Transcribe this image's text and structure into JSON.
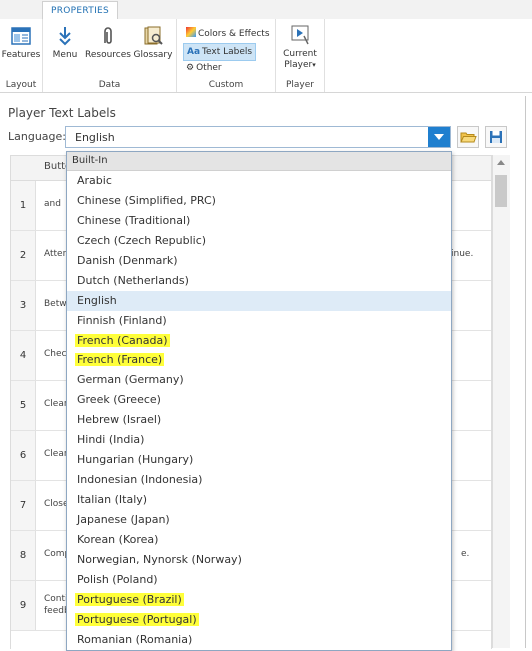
{
  "ribbon": {
    "tab": "PROPERTIES",
    "groups": {
      "layout": "Layout",
      "data": "Data",
      "custom": "Custom",
      "player": "Player"
    },
    "buttons": {
      "features": "Features",
      "menu": "Menu",
      "resources": "Resources",
      "glossary": "Glossary",
      "colors_effects": "Colors & Effects",
      "text_labels": "Text Labels",
      "other": "Other",
      "current_player_line1": "Current",
      "current_player_line2": "Player"
    }
  },
  "panel": {
    "title": "Player Text Labels",
    "language_label": "Language:",
    "language_value": "English"
  },
  "grid": {
    "header": "Butto",
    "rows": [
      {
        "num": "1",
        "text": "and",
        "right": ""
      },
      {
        "num": "2",
        "text": "Atten",
        "right": "inue."
      },
      {
        "num": "3",
        "text": "Betw",
        "right": ""
      },
      {
        "num": "4",
        "text": "Checl",
        "right": ""
      },
      {
        "num": "5",
        "text": "Clear",
        "right": ""
      },
      {
        "num": "6",
        "text": "Clear",
        "right": ""
      },
      {
        "num": "7",
        "text": "Close",
        "right": ""
      },
      {
        "num": "8",
        "text": "Comp",
        "right": "e."
      },
      {
        "num": "9",
        "text": "Conti feedb",
        "right": ""
      }
    ]
  },
  "dropdown": {
    "header": "Built-In",
    "items": [
      {
        "label": "Arabic",
        "selected": false,
        "highlighted": false
      },
      {
        "label": "Chinese (Simplified, PRC)",
        "selected": false,
        "highlighted": false
      },
      {
        "label": "Chinese (Traditional)",
        "selected": false,
        "highlighted": false
      },
      {
        "label": "Czech (Czech Republic)",
        "selected": false,
        "highlighted": false
      },
      {
        "label": "Danish (Denmark)",
        "selected": false,
        "highlighted": false
      },
      {
        "label": "Dutch (Netherlands)",
        "selected": false,
        "highlighted": false
      },
      {
        "label": "English",
        "selected": true,
        "highlighted": false
      },
      {
        "label": "Finnish (Finland)",
        "selected": false,
        "highlighted": false
      },
      {
        "label": "French (Canada)",
        "selected": false,
        "highlighted": true
      },
      {
        "label": "French (France)",
        "selected": false,
        "highlighted": true
      },
      {
        "label": "German (Germany)",
        "selected": false,
        "highlighted": false
      },
      {
        "label": "Greek (Greece)",
        "selected": false,
        "highlighted": false
      },
      {
        "label": "Hebrew (Israel)",
        "selected": false,
        "highlighted": false
      },
      {
        "label": "Hindi (India)",
        "selected": false,
        "highlighted": false
      },
      {
        "label": "Hungarian (Hungary)",
        "selected": false,
        "highlighted": false
      },
      {
        "label": "Indonesian (Indonesia)",
        "selected": false,
        "highlighted": false
      },
      {
        "label": "Italian (Italy)",
        "selected": false,
        "highlighted": false
      },
      {
        "label": "Japanese (Japan)",
        "selected": false,
        "highlighted": false
      },
      {
        "label": "Korean (Korea)",
        "selected": false,
        "highlighted": false
      },
      {
        "label": "Norwegian, Nynorsk (Norway)",
        "selected": false,
        "highlighted": false
      },
      {
        "label": "Polish (Poland)",
        "selected": false,
        "highlighted": false
      },
      {
        "label": "Portuguese (Brazil)",
        "selected": false,
        "highlighted": true
      },
      {
        "label": "Portuguese (Portugal)",
        "selected": false,
        "highlighted": true
      },
      {
        "label": "Romanian (Romania)",
        "selected": false,
        "highlighted": false
      }
    ]
  },
  "colors": {
    "accent": "#1f7fcf",
    "selected_row": "#deebf7",
    "highlight": "#ffff3a"
  }
}
